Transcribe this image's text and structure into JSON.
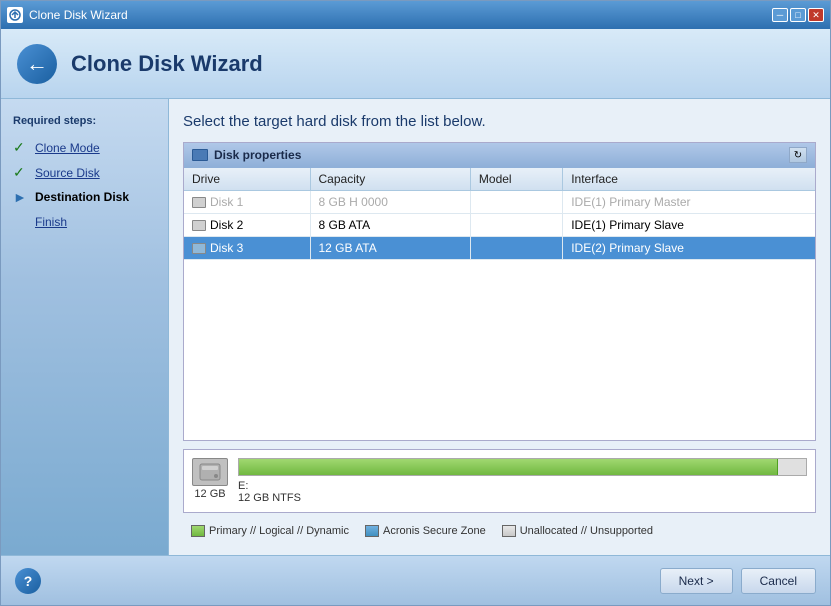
{
  "window": {
    "title": "Clone Disk Wizard",
    "title_btn_min": "─",
    "title_btn_max": "□",
    "title_btn_close": "✕"
  },
  "header": {
    "title": "Clone Disk Wizard"
  },
  "sidebar": {
    "section_label": "Required steps:",
    "items": [
      {
        "id": "clone-mode",
        "label": "Clone Mode",
        "state": "done"
      },
      {
        "id": "source-disk",
        "label": "Source Disk",
        "state": "done"
      },
      {
        "id": "destination-disk",
        "label": "Destination Disk",
        "state": "active"
      },
      {
        "id": "finish",
        "label": "Finish",
        "state": "pending"
      }
    ]
  },
  "main": {
    "instruction": "Select the target hard disk from the list below.",
    "disk_properties_title": "Disk properties",
    "table": {
      "columns": [
        "Drive",
        "Capacity",
        "Model",
        "Interface"
      ],
      "rows": [
        {
          "id": "disk1",
          "drive": "Disk 1",
          "capacity": "8 GB H 0000",
          "model": "",
          "interface": "IDE(1) Primary Master",
          "state": "disabled"
        },
        {
          "id": "disk2",
          "drive": "Disk 2",
          "capacity": "8 GB ATA",
          "model": "",
          "interface": "IDE(1) Primary Slave",
          "state": "normal"
        },
        {
          "id": "disk3",
          "drive": "Disk 3",
          "capacity": "12 GB ATA",
          "model": "",
          "interface": "IDE(2) Primary Slave",
          "state": "selected"
        }
      ]
    },
    "bottom_info": {
      "size_label": "12 GB",
      "drive_letter": "E:",
      "partition_size": "12 GB  NTFS",
      "bar_pct": 95
    },
    "legend": [
      {
        "type": "primary",
        "label": "Primary // Logical // Dynamic"
      },
      {
        "type": "acronis",
        "label": "Acronis Secure Zone"
      },
      {
        "type": "unalloc",
        "label": "Unallocated // Unsupported"
      }
    ]
  },
  "footer": {
    "next_label": "Next >",
    "cancel_label": "Cancel",
    "help_label": "?"
  }
}
